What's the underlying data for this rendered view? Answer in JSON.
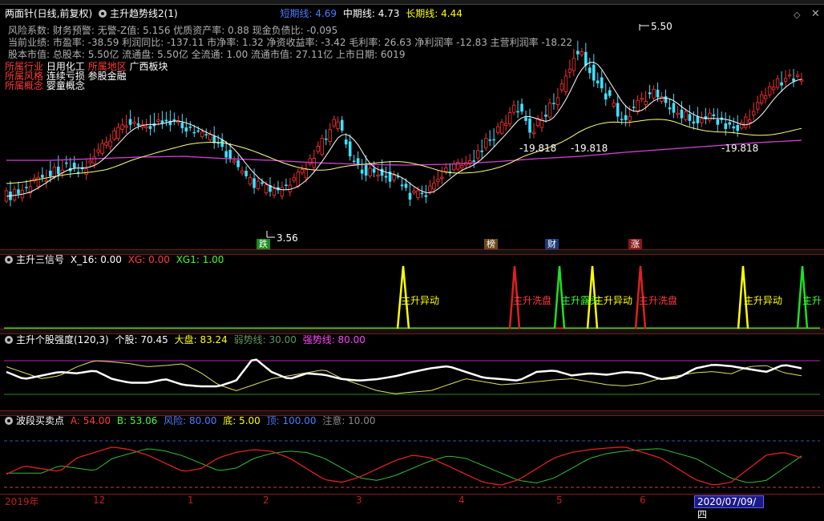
{
  "panel1": {
    "title": "两面针(日线,前复权)",
    "indicator": "主升趋势线2(1)",
    "short_label": "短期线: 4.69",
    "mid_label": "中期线: 4.73",
    "long_label": "长期线: 4.44",
    "info_line1": "风险系数: 财务预警: 无警-Z值: 5.156 优质资产率: 0.88 现金负债比: -0.095",
    "info_line2": "当前业绩: 市盈率: -38.59 利润同比: -137.11 市净率: 1.32 净资收益率: -3.42 毛利率: 26.63 净利润率 -12.83 主营利润率 -18.22",
    "info_line3": "股本市值: 总股本: 5.50亿 流通盘: 5.50亿 全流通: 1.00 流通市值: 27.11亿 上市日期: 6019",
    "industry_label": "所属行业",
    "industry_value": "日用化工",
    "region_label": "所属地区",
    "region_value": "广西板块",
    "style_label": "所属风格",
    "style_value": "连续亏损 参股金融",
    "concept_label": "所属概念",
    "concept_value": "婴童概念",
    "high_label": "5.50",
    "low_label": "3.56",
    "level_labels": [
      "-19.818",
      "-19.818",
      "-19.818"
    ],
    "badges": [
      "跌",
      "榜",
      "财",
      "涨"
    ],
    "colors": {
      "up": "#ff3030",
      "down": "#40e0ff",
      "short": "#ffffff",
      "mid": "#ffff80",
      "long": "#d040d0"
    }
  },
  "panel2": {
    "indicator": "主升三信号",
    "x16": "X_16: 0.00",
    "xg": "XG: 0.00",
    "xg1": "XG1: 1.00",
    "signals": [
      "主升异动",
      "主升洗盘",
      "主升露头",
      "主升异动",
      "主升洗盘",
      "主升异动",
      "主升"
    ]
  },
  "panel3": {
    "indicator": "主升个股强度(120,3)",
    "stock": "个股: 70.45",
    "market": "大盘: 83.24",
    "weak": "弱势线: 30.00",
    "strong": "强势线: 80.00"
  },
  "panel4": {
    "indicator": "波段买卖点",
    "a": "A: 54.00",
    "b": "B: 53.06",
    "risk": "风险: 80.00",
    "bottom": "底: 5.00",
    "top": "顶: 100.00",
    "attention": "注意: 10.00"
  },
  "timeaxis": {
    "labels": [
      "2019年",
      "12",
      "1",
      "2",
      "3",
      "4",
      "5",
      "6"
    ],
    "current_date": "2020/07/09/四"
  }
}
